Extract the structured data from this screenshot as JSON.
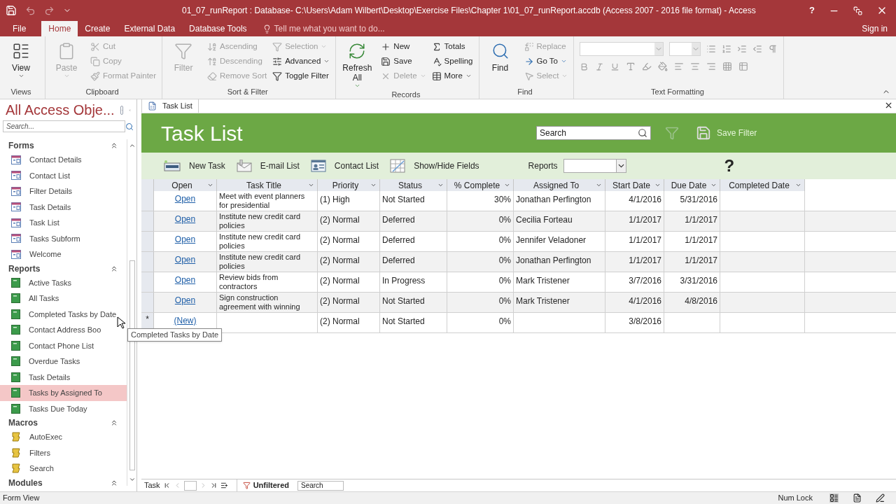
{
  "title_bar": {
    "title": "01_07_runReport : Database- C:\\Users\\Adam Wilbert\\Desktop\\Exercise Files\\Chapter 1\\01_07_runReport.accdb (Access 2007 - 2016 file format) - Access",
    "help": "?"
  },
  "ribbon_tabs": [
    {
      "label": "File",
      "selected": false
    },
    {
      "label": "Home",
      "selected": true
    },
    {
      "label": "Create",
      "selected": false
    },
    {
      "label": "External Data",
      "selected": false
    },
    {
      "label": "Database Tools",
      "selected": false
    }
  ],
  "tell_me": {
    "placeholder": "Tell me what you want to do..."
  },
  "sign_in": "Sign in",
  "ribbon_groups": [
    {
      "label": "Views",
      "kind": "views",
      "commands": [
        {
          "label": "View",
          "disabled": false,
          "dropdown": true
        }
      ]
    },
    {
      "label": "Clipboard",
      "kind": "clipboard",
      "commands": [
        {
          "label": "Paste",
          "disabled": true,
          "dropdown": true
        },
        {
          "label": "Cut",
          "disabled": true,
          "dropdown": false
        },
        {
          "label": "Copy",
          "disabled": true,
          "dropdown": false
        },
        {
          "label": "Format Painter",
          "disabled": true,
          "dropdown": false
        }
      ]
    },
    {
      "label": "Sort & Filter",
      "kind": "sort",
      "commands": [
        {
          "label": "Filter",
          "disabled": true,
          "dropdown": false
        },
        {
          "label": "Ascending",
          "disabled": true,
          "dropdown": false
        },
        {
          "label": "Descending",
          "disabled": true,
          "dropdown": false
        },
        {
          "label": "Remove Sort",
          "disabled": true,
          "dropdown": false
        },
        {
          "label": "Selection",
          "disabled": true,
          "dropdown": true
        },
        {
          "label": "Advanced",
          "disabled": false,
          "dropdown": true
        },
        {
          "label": "Toggle Filter",
          "disabled": false,
          "dropdown": false
        }
      ]
    },
    {
      "label": "Records",
      "kind": "records",
      "commands": [
        {
          "label": "Refresh All",
          "disabled": false,
          "dropdown": true
        },
        {
          "label": "New",
          "disabled": false,
          "dropdown": false
        },
        {
          "label": "Save",
          "disabled": false,
          "dropdown": false
        },
        {
          "label": "Delete",
          "disabled": true,
          "dropdown": true
        },
        {
          "label": "Totals",
          "disabled": false,
          "dropdown": false
        },
        {
          "label": "Spelling",
          "disabled": false,
          "dropdown": false
        },
        {
          "label": "More",
          "disabled": false,
          "dropdown": true
        }
      ]
    },
    {
      "label": "Find",
      "kind": "find",
      "commands": [
        {
          "label": "Find",
          "disabled": false,
          "dropdown": false
        },
        {
          "label": "Replace",
          "disabled": true,
          "dropdown": false
        },
        {
          "label": "Go To",
          "disabled": false,
          "dropdown": true
        },
        {
          "label": "Select",
          "disabled": true,
          "dropdown": true
        }
      ]
    },
    {
      "label": "Text Formatting",
      "kind": "text_formatting"
    }
  ],
  "nav_pane": {
    "title": "All Access Obje...",
    "search": {
      "placeholder": "Search..."
    },
    "sections": [
      {
        "label": "Forms",
        "kind": "form",
        "items": [
          {
            "label": "Contact Details",
            "selected": false
          },
          {
            "label": "Contact List",
            "selected": false
          },
          {
            "label": "Filter Details",
            "selected": false
          },
          {
            "label": "Task Details",
            "selected": false
          },
          {
            "label": "Task List",
            "selected": false
          },
          {
            "label": "Tasks Subform",
            "selected": false
          },
          {
            "label": "Welcome",
            "selected": false
          }
        ]
      },
      {
        "label": "Reports",
        "kind": "report",
        "items": [
          {
            "label": "Active Tasks",
            "selected": false
          },
          {
            "label": "All Tasks",
            "selected": false
          },
          {
            "label": "Completed Tasks by Date",
            "selected": false
          },
          {
            "label": "Contact Address Boo",
            "selected": false
          },
          {
            "label": "Contact Phone List",
            "selected": false
          },
          {
            "label": "Overdue Tasks",
            "selected": false
          },
          {
            "label": "Task Details",
            "selected": false
          },
          {
            "label": "Tasks by Assigned To",
            "selected": true
          },
          {
            "label": "Tasks Due Today",
            "selected": false
          }
        ]
      },
      {
        "label": "Macros",
        "kind": "macro",
        "items": [
          {
            "label": "AutoExec",
            "selected": false
          },
          {
            "label": "Filters",
            "selected": false
          },
          {
            "label": "Search",
            "selected": false
          }
        ]
      },
      {
        "label": "Modules"
      }
    ],
    "tooltip": "Completed Tasks by Date"
  },
  "document_tab": {
    "label": "Task List"
  },
  "form": {
    "title": "Task List",
    "search": {
      "value": "Search"
    },
    "save_filter": "Save Filter",
    "actions": [
      "New Task",
      "E-mail List",
      "Contact List",
      "Show/Hide Fields"
    ],
    "reports_label": "Reports",
    "help": "?"
  },
  "table": {
    "columns": [
      "Open",
      "Task Title",
      "Priority",
      "Status",
      "% Complete",
      "Assigned To",
      "Start Date",
      "Due Date",
      "Completed Date"
    ],
    "rows": [
      [
        "Open",
        "Meet with event planners for presidential",
        "(1) High",
        "Not Started",
        "30%",
        "Jonathan Perfington",
        "4/1/2016",
        "5/31/2016"
      ],
      [
        "Open",
        "Institute new credit card policies",
        "(2) Normal",
        "Deferred",
        "0%",
        "Cecilia Forteau",
        "1/1/2017",
        "1/1/2017"
      ],
      [
        "Open",
        "Institute new credit card policies",
        "(2) Normal",
        "Deferred",
        "0%",
        "Jennifer Veladoner",
        "1/1/2017",
        "1/1/2017"
      ],
      [
        "Open",
        "Institute new credit card policies",
        "(2) Normal",
        "Deferred",
        "0%",
        "Jonathan Perfington",
        "1/1/2017",
        "1/1/2017"
      ],
      [
        "Open",
        "Review bids from contractors",
        "(2) Normal",
        "In Progress",
        "0%",
        "Mark Tristener",
        "3/7/2016",
        "3/31/2016"
      ],
      [
        "Open",
        "Sign construction agreement with winning",
        "(2) Normal",
        "Not Started",
        "0%",
        "Mark Tristener",
        "4/1/2016",
        "4/8/2016"
      ]
    ],
    "new_row": {
      "marker": "*",
      "cells": [
        "(New)",
        "",
        "(2) Normal",
        "Not Started",
        "0%",
        "",
        "3/8/2016",
        ""
      ]
    }
  },
  "record_nav": {
    "label": "Task",
    "filter": "Unfiltered",
    "search": {
      "placeholder": "Search"
    }
  },
  "status_bar": {
    "view": "Form View",
    "num_lock": "Num Lock"
  }
}
